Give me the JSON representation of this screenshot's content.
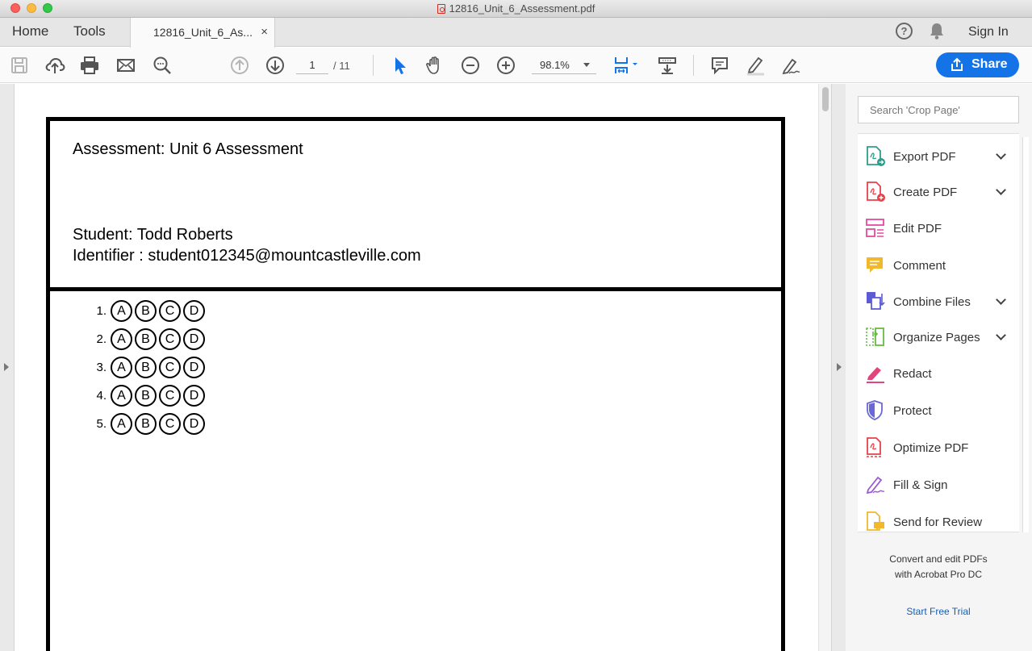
{
  "window": {
    "title": "12816_Unit_6_Assessment.pdf"
  },
  "tabs": {
    "home": "Home",
    "tools": "Tools",
    "document": "12816_Unit_6_As...",
    "close_glyph": "×",
    "help_glyph": "?",
    "sign_in": "Sign In"
  },
  "toolbar": {
    "page_current": "1",
    "page_total": "/ 11",
    "zoom": "98.1%",
    "share_label": "Share"
  },
  "document": {
    "assessment_label": "Assessment: Unit 6 Assessment",
    "student_label": "Student: Todd Roberts",
    "identifier_label": "Identifier : student012345@mountcastleville.com",
    "questions": [
      {
        "number": "1.",
        "options": [
          "A",
          "B",
          "C",
          "D"
        ]
      },
      {
        "number": "2.",
        "options": [
          "A",
          "B",
          "C",
          "D"
        ]
      },
      {
        "number": "3.",
        "options": [
          "A",
          "B",
          "C",
          "D"
        ]
      },
      {
        "number": "4.",
        "options": [
          "A",
          "B",
          "C",
          "D"
        ]
      },
      {
        "number": "5.",
        "options": [
          "A",
          "B",
          "C",
          "D"
        ]
      }
    ]
  },
  "right_panel": {
    "search_placeholder": "Search 'Crop Page'",
    "tools": [
      {
        "label": "Export PDF",
        "icon": "export-pdf-icon",
        "color": "#2e9c8c",
        "expandable": true
      },
      {
        "label": "Create PDF",
        "icon": "create-pdf-icon",
        "color": "#e5414a",
        "expandable": true
      },
      {
        "label": "Edit PDF",
        "icon": "edit-pdf-icon",
        "color": "#e34aa0",
        "expandable": false
      },
      {
        "label": "Comment",
        "icon": "comment-icon",
        "color": "#f1b82b",
        "expandable": false
      },
      {
        "label": "Combine Files",
        "icon": "combine-files-icon",
        "color": "#5b5bd6",
        "expandable": true
      },
      {
        "label": "Organize Pages",
        "icon": "organize-pages-icon",
        "color": "#66bb44",
        "expandable": true
      },
      {
        "label": "Redact",
        "icon": "redact-icon",
        "color": "#e0457b",
        "expandable": false
      },
      {
        "label": "Protect",
        "icon": "protect-icon",
        "color": "#6a67d9",
        "expandable": false
      },
      {
        "label": "Optimize PDF",
        "icon": "optimize-pdf-icon",
        "color": "#e5414a",
        "expandable": false
      },
      {
        "label": "Fill & Sign",
        "icon": "fill-sign-icon",
        "color": "#9b5ad6",
        "expandable": false
      },
      {
        "label": "Send for Review",
        "icon": "send-for-review-icon",
        "color": "#f1b82b",
        "expandable": false
      }
    ],
    "promo_line1": "Convert and edit PDFs",
    "promo_line2": "with Acrobat Pro DC",
    "trial_link": "Start Free Trial"
  },
  "colors": {
    "accent": "#1473e6",
    "link": "#1a5cad",
    "select_tool": "#1473e6"
  }
}
